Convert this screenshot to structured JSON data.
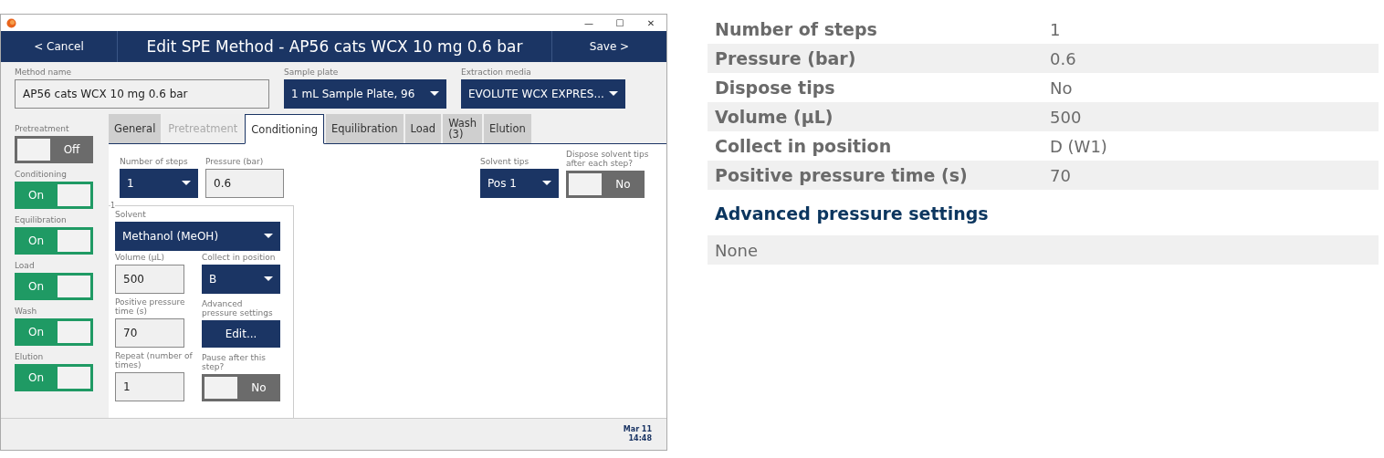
{
  "window": {
    "controls": [
      "—",
      "☐",
      "✕"
    ]
  },
  "header": {
    "cancel": "< Cancel",
    "title": "Edit SPE Method - AP56 cats WCX 10 mg 0.6 bar",
    "save": "Save >"
  },
  "fields": {
    "method_name": {
      "label": "Method name",
      "value": "AP56 cats WCX 10 mg 0.6 bar"
    },
    "sample_plate": {
      "label": "Sample plate",
      "value": "1 mL Sample Plate, 96"
    },
    "extraction_media": {
      "label": "Extraction media",
      "value": "EVOLUTE WCX EXPRES..."
    }
  },
  "sidebar": [
    {
      "label": "Pretreatment",
      "text": "Off",
      "on": false
    },
    {
      "label": "Conditioning",
      "text": "On",
      "on": true
    },
    {
      "label": "Equilibration",
      "text": "On",
      "on": true
    },
    {
      "label": "Load",
      "text": "On",
      "on": true
    },
    {
      "label": "Wash",
      "text": "On",
      "on": true
    },
    {
      "label": "Elution",
      "text": "On",
      "on": true
    }
  ],
  "tabs": [
    {
      "label": "General",
      "selected": false,
      "disabled": false
    },
    {
      "label": "Pretreatment",
      "selected": false,
      "disabled": true
    },
    {
      "label": "Conditioning",
      "selected": true,
      "disabled": false
    },
    {
      "label": "Equilibration",
      "selected": false,
      "disabled": false
    },
    {
      "label": "Load",
      "selected": false,
      "disabled": false
    },
    {
      "label": "Wash\n(3)",
      "selected": false,
      "disabled": false
    },
    {
      "label": "Elution",
      "selected": false,
      "disabled": false
    }
  ],
  "conditioning": {
    "number_of_steps": {
      "label": "Number of steps",
      "value": "1"
    },
    "pressure": {
      "label": "Pressure (bar)",
      "value": "0.6"
    },
    "solvent_tips": {
      "label": "Solvent tips",
      "value": "Pos 1"
    },
    "dispose_tips": {
      "label": "Dispose solvent tips after each step?",
      "text": "No",
      "on": false
    },
    "step": {
      "number": "1",
      "solvent": {
        "label": "Solvent",
        "value": "Methanol (MeOH)"
      },
      "volume": {
        "label": "Volume (µL)",
        "value": "500"
      },
      "collect": {
        "label": "Collect in position",
        "value": "B"
      },
      "pp_time": {
        "label": "Positive pressure time (s)",
        "value": "70"
      },
      "advanced": {
        "label": "Advanced pressure settings",
        "button": "Edit..."
      },
      "repeat": {
        "label": "Repeat (number of times)",
        "value": "1"
      },
      "pause": {
        "label": "Pause after this step?",
        "text": "No",
        "on": false
      }
    }
  },
  "status_bar": {
    "date": "Mar 11",
    "time": "14:48"
  },
  "summary": {
    "rows": [
      {
        "label": "Number of steps",
        "value": "1"
      },
      {
        "label": "Pressure (bar)",
        "value": "0.6"
      },
      {
        "label": "Dispose tips",
        "value": "No"
      },
      {
        "label": "Volume (µL)",
        "value": "500"
      },
      {
        "label": "Collect in position",
        "value": "D (W1)"
      },
      {
        "label": "Positive pressure time (s)",
        "value": "70"
      }
    ],
    "advanced_heading": "Advanced pressure settings",
    "advanced_value": "None"
  }
}
